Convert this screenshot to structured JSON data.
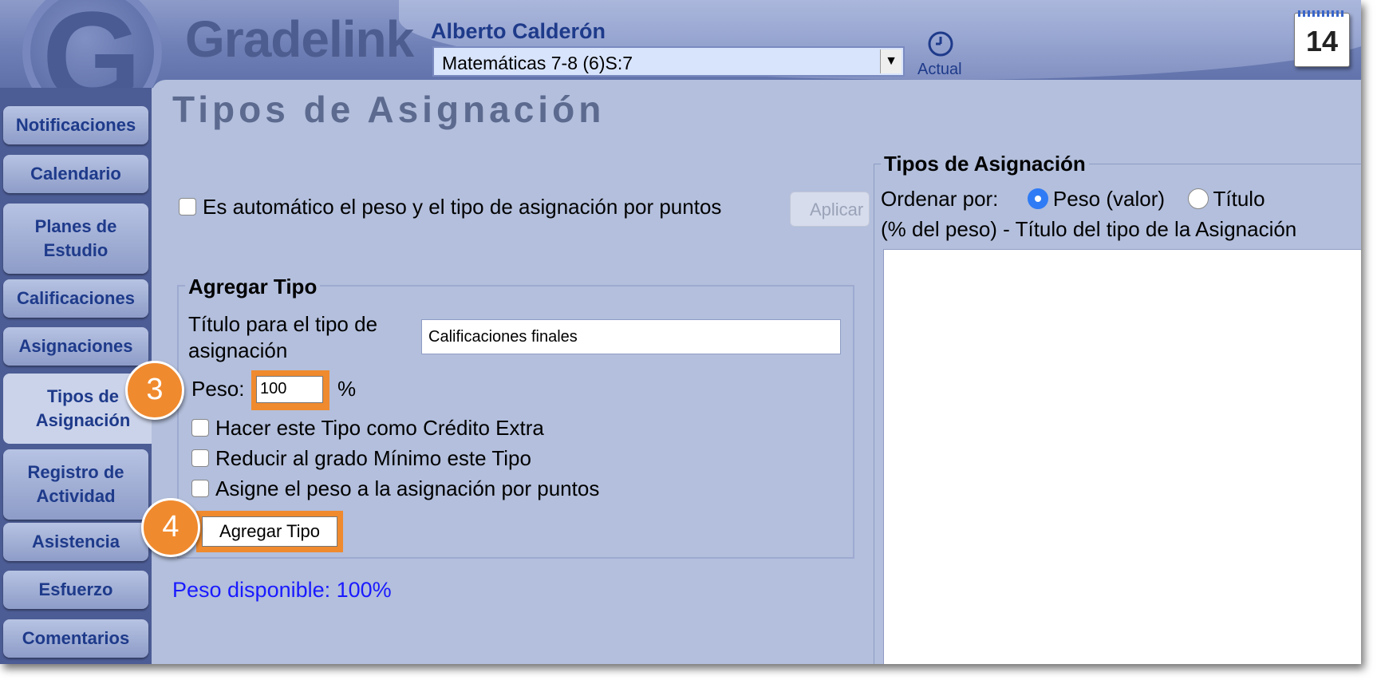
{
  "header": {
    "brand": "Gradelink",
    "logo_letter": "G",
    "teacher_name": "Alberto Calderón",
    "class_select": {
      "value": "Matemáticas 7-8 (6)S:7"
    },
    "actual_label": "Actual",
    "calendar_day": "14"
  },
  "sidebar": {
    "items": [
      {
        "label": "Notificaciones"
      },
      {
        "label": "Calendario"
      },
      {
        "label": "Planes de Estudio"
      },
      {
        "label": "Calificaciones"
      },
      {
        "label": "Asignaciones"
      },
      {
        "label": "Tipos de Asignación"
      },
      {
        "label": "Registro de Actividad"
      },
      {
        "label": "Asistencia"
      },
      {
        "label": "Esfuerzo"
      },
      {
        "label": "Comentarios"
      }
    ]
  },
  "page": {
    "title": "Tipos de Asignación",
    "auto_label": "Es automático el peso y el tipo de asignación por puntos",
    "apply_label": "Aplicar"
  },
  "add_type": {
    "legend": "Agregar Tipo",
    "title_label": "Título para el tipo de asignación",
    "title_value": "Calificaciones finales",
    "weight_label": "Peso:",
    "weight_value": "100",
    "percent_sign": "%",
    "extra_credit_label": "Hacer este Tipo como Crédito Extra",
    "min_grade_label": "Reducir al grado Mínimo este Tipo",
    "points_label": "Asigne el peso a la asignación por puntos",
    "button_label": "Agregar Tipo"
  },
  "available_weight": "Peso disponible: 100%",
  "types_panel": {
    "legend": "Tipos de Asignación",
    "sort_label": "Ordenar por:",
    "sort_weight": "Peso (valor)",
    "sort_title": "Título",
    "list_header": "(% del peso) - Título del tipo de la Asignación"
  },
  "steps": {
    "weight": "3",
    "add": "4"
  },
  "colors": {
    "accent": "#1e3a8a",
    "highlight": "#f08a2e",
    "available": "#1a1aff"
  }
}
